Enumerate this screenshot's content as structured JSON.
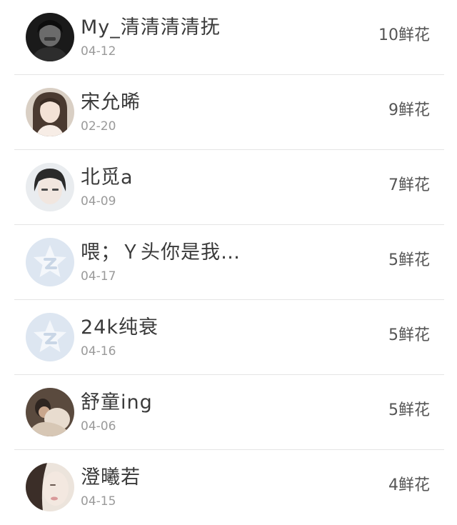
{
  "rows": [
    {
      "name": "My_清清清清抚",
      "date": "04-12",
      "flowers": "10鲜花",
      "avatar": "photo-boy-dark"
    },
    {
      "name": "宋允晞",
      "date": "02-20",
      "flowers": "9鲜花",
      "avatar": "photo-girl-light"
    },
    {
      "name": "北觅a",
      "date": "04-09",
      "flowers": "7鲜花",
      "avatar": "photo-boy-light"
    },
    {
      "name": "喂；Ｙ头你是我…",
      "date": "04-17",
      "flowers": "5鲜花",
      "avatar": "default-qzone-star-icon"
    },
    {
      "name": "24k纯衰",
      "date": "04-16",
      "flowers": "5鲜花",
      "avatar": "default-qzone-star-icon"
    },
    {
      "name": "舒童ing",
      "date": "04-06",
      "flowers": "5鲜花",
      "avatar": "photo-couple"
    },
    {
      "name": "澄曦若",
      "date": "04-15",
      "flowers": "4鲜花",
      "avatar": "photo-girl-side"
    }
  ],
  "colors": {
    "default_avatar_bg": "#dde6f1",
    "default_avatar_star": "#f4f7fb",
    "separator": "#e4e4e4"
  }
}
